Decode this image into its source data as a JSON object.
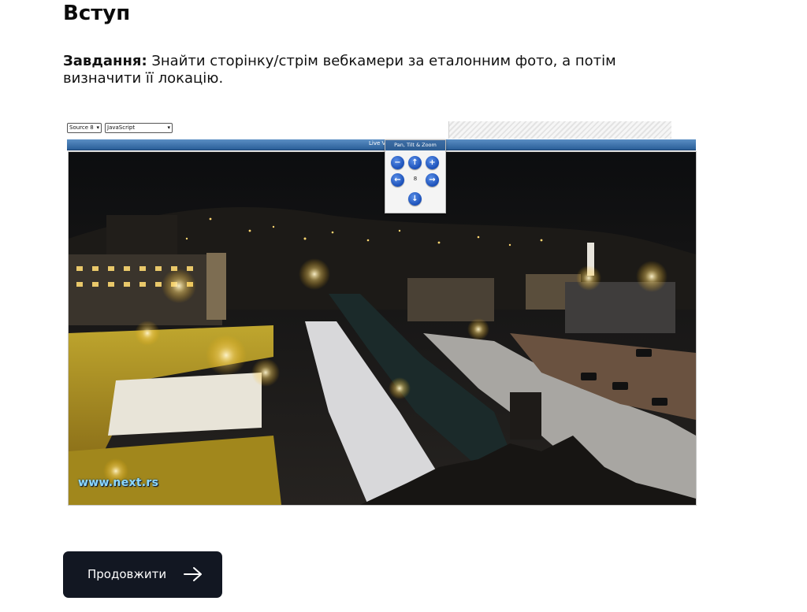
{
  "page": {
    "title": "Вступ",
    "task_label": "Завдання:",
    "task_text": " Знайти сторінку/стрім вебкамери за еталонним фото, а потім визначити її локацію."
  },
  "webcam": {
    "source_select": "Source 8",
    "script_select": "JavaScript",
    "live_label": "Live V",
    "ptz_title": "Pan, Tilt & Zoom",
    "ptz_speed": "8",
    "watermark": "www.next.rs"
  },
  "actions": {
    "continue_label": "Продовжити"
  },
  "colors": {
    "button_bg": "#121722",
    "accent_blue": "#2a5f98"
  },
  "icons": {
    "continue": "arrow-right-icon",
    "zoom_in": "zoom-in-icon",
    "zoom_out": "zoom-out-icon",
    "pan_up": "arrow-up-icon",
    "pan_down": "arrow-down-icon",
    "pan_left": "arrow-left-icon",
    "pan_right": "arrow-right-icon"
  }
}
